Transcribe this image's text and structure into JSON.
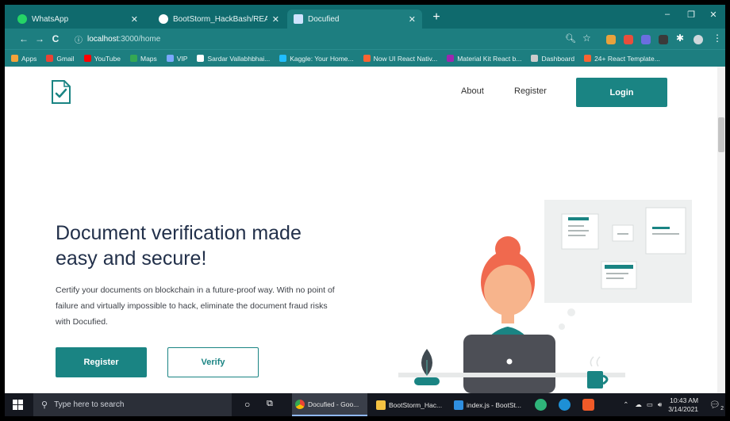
{
  "browser": {
    "tabs": [
      {
        "title": "WhatsApp",
        "icon": "whatsapp-icon",
        "active": false
      },
      {
        "title": "BootStorm_HackBash/README...",
        "icon": "github-icon",
        "active": false
      },
      {
        "title": "Docufied",
        "icon": "docufied-favicon",
        "active": true
      }
    ],
    "new_tab": "+",
    "window_controls": {
      "minimize": "–",
      "restore": "❐",
      "close": "✕"
    },
    "address": {
      "host": "localhost",
      "path": ":3000/home"
    },
    "nav": {
      "back": "←",
      "forward": "→",
      "reload": "C",
      "info": "ⓘ"
    },
    "bookmarks": [
      {
        "label": "Apps",
        "color": "#f2a33a"
      },
      {
        "label": "Gmail",
        "color": "#ea4335"
      },
      {
        "label": "YouTube",
        "color": "#ff0000"
      },
      {
        "label": "Maps",
        "color": "#34a853"
      },
      {
        "label": "VIP",
        "color": "#7aa8ff"
      },
      {
        "label": "Sardar Vallabhbhai...",
        "color": "#ffffff"
      },
      {
        "label": "Kaggle: Your Home...",
        "color": "#20beff"
      },
      {
        "label": "Now UI React Nativ...",
        "color": "#f96332"
      },
      {
        "label": "Material Kit React b...",
        "color": "#9c27b0"
      },
      {
        "label": "Dashboard",
        "color": "#cccccc"
      },
      {
        "label": "24+ React Template...",
        "color": "#f96332"
      }
    ]
  },
  "site": {
    "nav": {
      "about": "About",
      "register": "Register",
      "login": "Login"
    },
    "hero": {
      "headline_line1": "Document verification made",
      "headline_line2": "easy and secure!",
      "subtext": "Certify your documents on blockchain in a future-proof way. With no point of failure and virtually impossible to hack, eliminate the document fraud risks with Docufied.",
      "register_label": "Register",
      "verify_label": "Verify"
    },
    "accent": "#1a8483"
  },
  "taskbar": {
    "search_placeholder": "Type here to search",
    "apps": [
      {
        "label": "Docufied - Goo...",
        "active": true
      },
      {
        "label": "BootStorm_Hac...",
        "active": false
      },
      {
        "label": "index.js - BootSt...",
        "active": false
      }
    ],
    "time": "10:43 AM",
    "date": "3/14/2021",
    "notifications": "2"
  }
}
